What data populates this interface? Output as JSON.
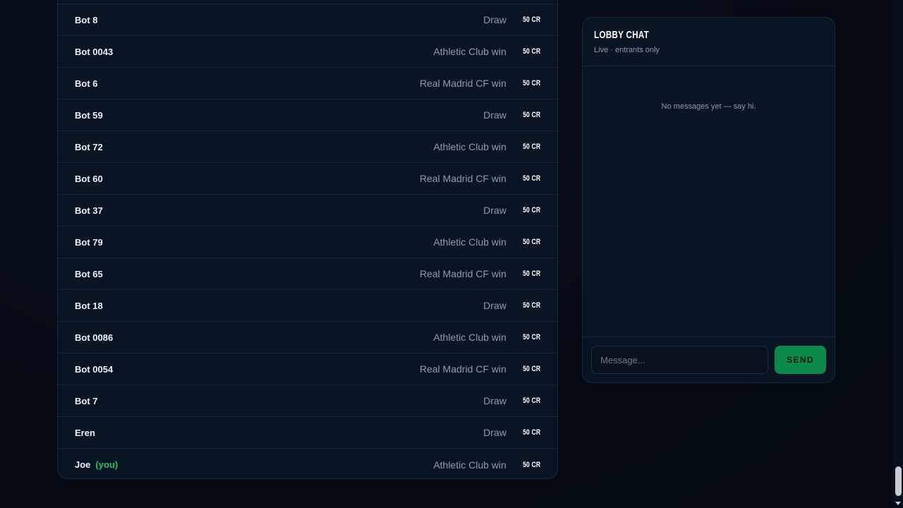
{
  "entries": [
    {
      "name": "Bot 8",
      "you": "",
      "pick": "Draw",
      "stake": "50 CR"
    },
    {
      "name": "Bot 0043",
      "you": "",
      "pick": "Athletic Club win",
      "stake": "50 CR"
    },
    {
      "name": "Bot 6",
      "you": "",
      "pick": "Real Madrid CF win",
      "stake": "50 CR"
    },
    {
      "name": "Bot 59",
      "you": "",
      "pick": "Draw",
      "stake": "50 CR"
    },
    {
      "name": "Bot 72",
      "you": "",
      "pick": "Athletic Club win",
      "stake": "50 CR"
    },
    {
      "name": "Bot 60",
      "you": "",
      "pick": "Real Madrid CF win",
      "stake": "50 CR"
    },
    {
      "name": "Bot 37",
      "you": "",
      "pick": "Draw",
      "stake": "50 CR"
    },
    {
      "name": "Bot 79",
      "you": "",
      "pick": "Athletic Club win",
      "stake": "50 CR"
    },
    {
      "name": "Bot 65",
      "you": "",
      "pick": "Real Madrid CF win",
      "stake": "50 CR"
    },
    {
      "name": "Bot 18",
      "you": "",
      "pick": "Draw",
      "stake": "50 CR"
    },
    {
      "name": "Bot 0086",
      "you": "",
      "pick": "Athletic Club win",
      "stake": "50 CR"
    },
    {
      "name": "Bot 0054",
      "you": "",
      "pick": "Real Madrid CF win",
      "stake": "50 CR"
    },
    {
      "name": "Bot 7",
      "you": "",
      "pick": "Draw",
      "stake": "50 CR"
    },
    {
      "name": "Eren",
      "you": "",
      "pick": "Draw",
      "stake": "50 CR"
    },
    {
      "name": "Joe",
      "you": "(you)",
      "pick": "Athletic Club win",
      "stake": "50 CR"
    }
  ],
  "chat": {
    "title": "LOBBY CHAT",
    "subtitle": "Live · entrants only",
    "empty_text": "No messages yet — say hi.",
    "input_placeholder": "Message...",
    "input_value": "",
    "send_label": "SEND"
  },
  "colors": {
    "background": "#050b16",
    "panel": "#0a1524",
    "accent_green": "#0c8a4a",
    "you_green": "#1ec46a",
    "muted_text": "#8f9aab"
  }
}
